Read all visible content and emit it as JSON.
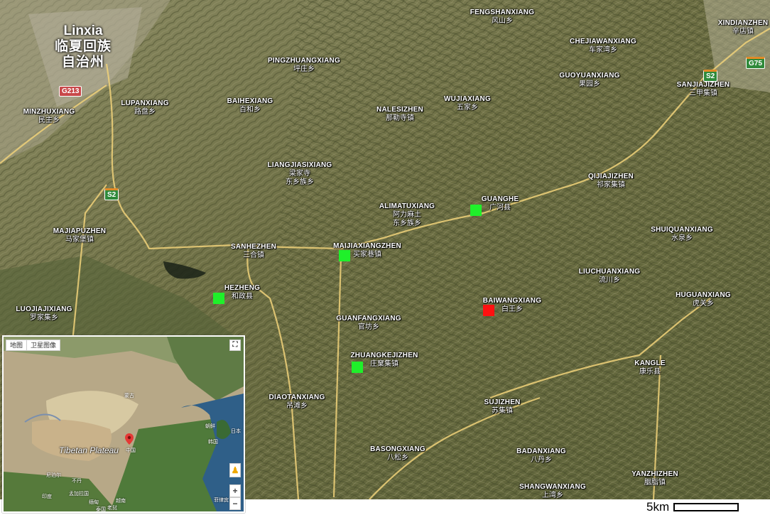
{
  "map": {
    "city": {
      "en": "Linxia",
      "zh": "临夏回族自治州"
    },
    "places": [
      {
        "id": "fengshanxiang",
        "en": "FENGSHANXIANG",
        "zh": "风山乡"
      },
      {
        "id": "xindianzhen",
        "en": "XINDIANZHEN",
        "zh": "辛店镇"
      },
      {
        "id": "chejiawanxiang",
        "en": "CHEJIAWANXIANG",
        "zh": "车家湾乡"
      },
      {
        "id": "pingzhuangxiang",
        "en": "PINGZHUANGXIANG",
        "zh": "坪庄乡"
      },
      {
        "id": "guoyuanxiang",
        "en": "GUOYUANXIANG",
        "zh": "果园乡"
      },
      {
        "id": "sanjiajizhen",
        "en": "SANJIAJIZHEN",
        "zh": "三甲集镇"
      },
      {
        "id": "lupanxiang",
        "en": "LUPANXIANG",
        "zh": "路盘乡"
      },
      {
        "id": "baihexiang",
        "en": "BAIHEXIANG",
        "zh": "百和乡"
      },
      {
        "id": "wujiaxiang",
        "en": "WUJIAXIANG",
        "zh": "五家乡"
      },
      {
        "id": "nalesizhen",
        "en": "NALESIZHEN",
        "zh": "那勒寺镇"
      },
      {
        "id": "minzhuxiang",
        "en": "MINZHUXIANG",
        "zh": "民主乡"
      },
      {
        "id": "liangjiasixiang",
        "en": "LIANGJIASIXIANG",
        "zh": "梁家寺\n东乡族乡"
      },
      {
        "id": "qijiajizhen",
        "en": "QIJIAJIZHEN",
        "zh": "祁家集镇"
      },
      {
        "id": "guanghe",
        "en": "GUANGHE",
        "zh": "广河县"
      },
      {
        "id": "alimatuxiang",
        "en": "ALIMATUXIANG",
        "zh": "阿力麻土\n东乡族乡"
      },
      {
        "id": "majiapuzhen",
        "en": "MAJIAPUZHEN",
        "zh": "马家堡镇"
      },
      {
        "id": "shuiquanxiang",
        "en": "SHUIQUANXIANG",
        "zh": "水泉乡"
      },
      {
        "id": "sanhezhen",
        "en": "SANHEZHEN",
        "zh": "三合镇"
      },
      {
        "id": "maijiaxiangzhen",
        "en": "MAIJIAXIANGZHEN",
        "zh": "买家巷镇"
      },
      {
        "id": "liuchuanxiang",
        "en": "LIUCHUANXIANG",
        "zh": "流川乡"
      },
      {
        "id": "hezheng",
        "en": "HEZHENG",
        "zh": "和政县"
      },
      {
        "id": "baiwangxiang",
        "en": "BAIWANGXIANG",
        "zh": "白王乡"
      },
      {
        "id": "huguanxiang",
        "en": "HUGUANXIANG",
        "zh": "虎关乡"
      },
      {
        "id": "luojiajixiang",
        "en": "LUOJIAJIXIANG",
        "zh": "罗家集乡"
      },
      {
        "id": "guanfangxiang",
        "en": "GUANFANGXIANG",
        "zh": "官坊乡"
      },
      {
        "id": "zhuangkejizhen",
        "en": "ZHUANGKEJIZHEN",
        "zh": "庄窠集镇"
      },
      {
        "id": "kangle",
        "en": "KANGLE",
        "zh": "康乐县"
      },
      {
        "id": "diaotanxiang",
        "en": "DIAOTANXIANG",
        "zh": "吊滩乡"
      },
      {
        "id": "sujizhen",
        "en": "SUJIZHEN",
        "zh": "苏集镇"
      },
      {
        "id": "basongxiang",
        "en": "BASONGXIANG",
        "zh": "八松乡"
      },
      {
        "id": "badanxiang",
        "en": "BADANXIANG",
        "zh": "八丹乡"
      },
      {
        "id": "yanzhizhen",
        "en": "YANZHIZHEN",
        "zh": "胭脂镇"
      },
      {
        "id": "shangwanxiang",
        "en": "SHANGWANXIANG",
        "zh": "上湾乡"
      }
    ],
    "road_shields": [
      {
        "id": "g213",
        "label": "G213",
        "color": "red"
      },
      {
        "id": "s2-west",
        "label": "S2",
        "color": "green"
      },
      {
        "id": "s2-east",
        "label": "S2",
        "color": "green"
      },
      {
        "id": "g75",
        "label": "G75",
        "color": "green"
      }
    ],
    "markers": [
      {
        "id": "guanghe",
        "color": "#1ff02a"
      },
      {
        "id": "maijiaxiangzhen",
        "color": "#1ff02a"
      },
      {
        "id": "hezheng",
        "color": "#1ff02a"
      },
      {
        "id": "zhuangkejizhen",
        "color": "#1ff02a"
      },
      {
        "id": "baiwangxiang",
        "color": "#ff1010"
      }
    ]
  },
  "inset": {
    "tabs": [
      "地图",
      "卫星图像"
    ],
    "fullscreen_icon": "fullscreen-icon",
    "zoom_in": "+",
    "zoom_out": "−",
    "pegman_icon": "pegman-icon",
    "pin_icon": "location-pin-icon",
    "pin_color": "#e53935",
    "region_label": "Tibetan Plateau",
    "country_label": "中国",
    "labels": [
      "蒙古",
      "朝鲜",
      "韩国",
      "日本",
      "印度",
      "孟加拉国",
      "缅甸",
      "越南",
      "老挝",
      "泰国",
      "尼泊尔",
      "不丹",
      "菲律宾"
    ]
  },
  "scale": {
    "label": "5km"
  }
}
